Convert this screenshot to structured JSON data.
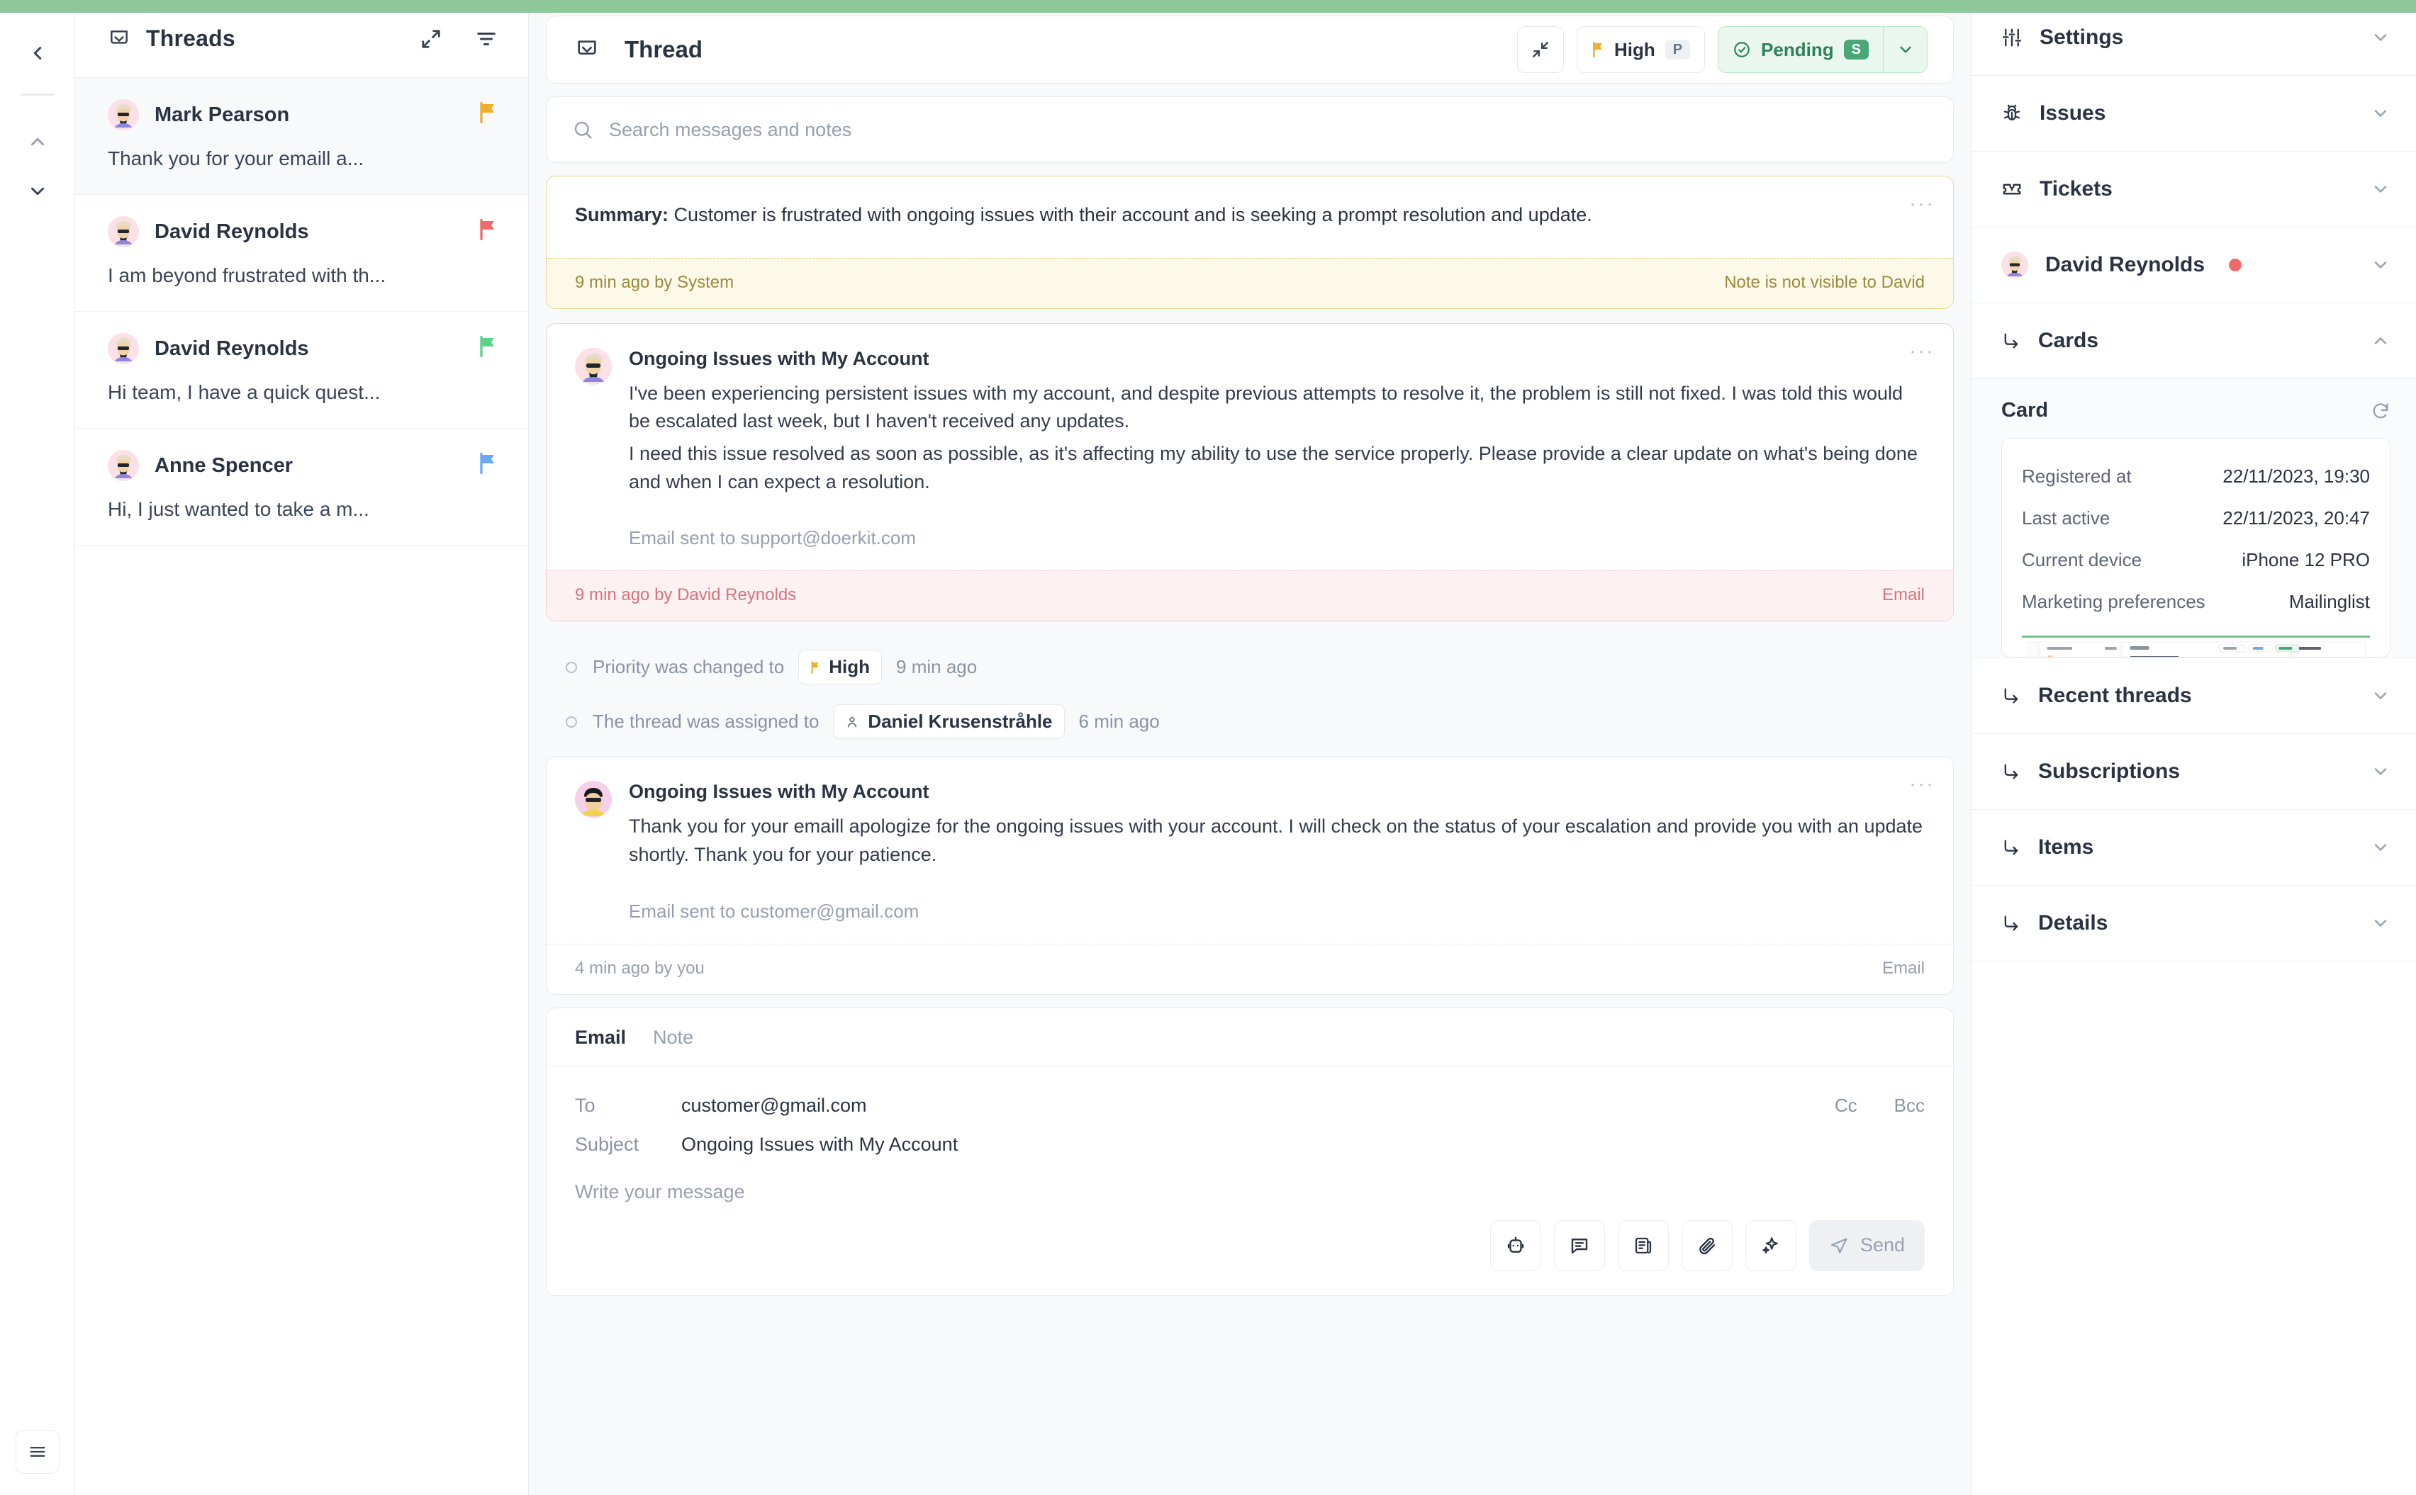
{
  "topbar": {
    "accent_color": "#8dc79a"
  },
  "rail": {
    "back_label": "back",
    "up_label": "previous",
    "down_label": "next",
    "menu_label": "menu"
  },
  "threads_panel": {
    "title": "Threads",
    "expand_label": "expand",
    "filter_label": "filter",
    "items": [
      {
        "name": "Mark Pearson",
        "preview": "Thank you for your emaill a...",
        "flag_color": "#f0ad2e",
        "active": true
      },
      {
        "name": "David Reynolds",
        "preview": "I am beyond frustrated with th...",
        "flag_color": "#ef6b6b",
        "active": false
      },
      {
        "name": "David Reynolds",
        "preview": "Hi team, I have a quick quest...",
        "flag_color": "#5bd18a",
        "active": false
      },
      {
        "name": "Anne Spencer",
        "preview": "Hi, I just wanted to take a m...",
        "flag_color": "#6aa8f5",
        "active": false
      }
    ]
  },
  "thread": {
    "title": "Thread",
    "collapse_label": "collapse",
    "priority": {
      "label": "High",
      "shortcut": "P",
      "flag_color": "#f0ad2e"
    },
    "status": {
      "label": "Pending",
      "shortcut": "S",
      "accent_color": "#2e8257",
      "bg_color": "#e9f7ee"
    },
    "search": {
      "placeholder": "Search messages and notes"
    },
    "note": {
      "label": "Summary:",
      "text": " Customer is frustrated with ongoing issues with their account and is seeking a prompt resolution and update.",
      "meta": "9 min ago by System",
      "visibility": "Note is not visible to David"
    },
    "messages": [
      {
        "subject": "Ongoing Issues with My Account",
        "paragraphs": [
          "I've been experiencing persistent issues with my account, and despite previous attempts to resolve it, the problem is still not fixed. I was told this would be escalated last week, but I haven't received any updates.",
          "I need this issue resolved as soon as possible, as it's affecting my ability to use the service properly. Please provide a clear update on what's being done and when I can expect a resolution."
        ],
        "sent_to": "Email sent to support@doerkit.com",
        "meta": "9 min ago by David Reynolds",
        "channel": "Email",
        "direction": "inbound"
      },
      {
        "subject": "Ongoing Issues with My Account",
        "paragraphs": [
          "Thank you for your emaill apologize for the ongoing issues with your account. I will check on the status of your escalation and provide you with an update shortly. Thank you for your patience."
        ],
        "sent_to": "Email sent to customer@gmail.com",
        "meta": "4 min ago by you",
        "channel": "Email",
        "direction": "outbound"
      }
    ],
    "activity": [
      {
        "text": "Priority was changed to",
        "chip": "High",
        "chip_type": "flag",
        "time": "9 min ago"
      },
      {
        "text": "The thread was assigned to",
        "chip": "Daniel Krusenstråhle",
        "chip_type": "person",
        "time": "6 min ago"
      }
    ]
  },
  "composer": {
    "tabs": [
      {
        "label": "Email",
        "active": true
      },
      {
        "label": "Note",
        "active": false
      }
    ],
    "to_label": "To",
    "to_value": "customer@gmail.com",
    "cc_label": "Cc",
    "bcc_label": "Bcc",
    "subject_label": "Subject",
    "subject_value": "Ongoing Issues with My Account",
    "message_placeholder": "Write your message",
    "tools": [
      {
        "name": "robot-icon",
        "label": "AI assistant"
      },
      {
        "name": "comment-icon",
        "label": "Canned reply"
      },
      {
        "name": "article-icon",
        "label": "Knowledge article"
      },
      {
        "name": "paperclip-icon",
        "label": "Attach file"
      },
      {
        "name": "sparkles-icon",
        "label": "Enhance"
      }
    ],
    "send_label": "Send"
  },
  "right_sidebar": {
    "sections": [
      {
        "label": "Settings",
        "icon": "sliders-icon",
        "expanded": false
      },
      {
        "label": "Issues",
        "icon": "bug-icon",
        "expanded": false
      },
      {
        "label": "Tickets",
        "icon": "ticket-icon",
        "expanded": false
      }
    ],
    "contact": {
      "name": "David Reynolds",
      "status_color": "#ef6b6b",
      "expanded": false
    },
    "cards_section": {
      "label": "Cards",
      "expanded": true
    },
    "card": {
      "title": "Card",
      "refresh_label": "refresh",
      "rows": [
        {
          "key": "Registered at",
          "value": "22/11/2023, 19:30"
        },
        {
          "key": "Last active",
          "value": "22/11/2023, 20:47"
        },
        {
          "key": "Current device",
          "value": "iPhone 12 PRO"
        },
        {
          "key": "Marketing preferences",
          "value": "Mailinglist"
        }
      ]
    },
    "lower_sections": [
      {
        "label": "Recent threads",
        "expanded": false
      },
      {
        "label": "Subscriptions",
        "expanded": false
      },
      {
        "label": "Items",
        "expanded": false
      },
      {
        "label": "Details",
        "expanded": false
      }
    ]
  }
}
